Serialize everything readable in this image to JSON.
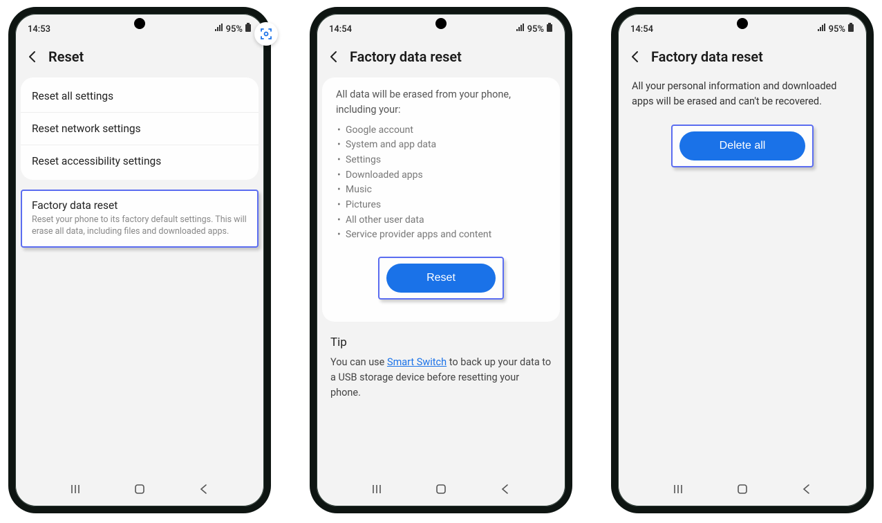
{
  "phones": [
    {
      "status": {
        "time": "14:53",
        "battery": "95%"
      },
      "title": "Reset",
      "items": [
        "Reset all settings",
        "Reset network settings",
        "Reset accessibility settings"
      ],
      "highlight": {
        "title": "Factory data reset",
        "desc": "Reset your phone to its factory default settings. This will erase all data, including files and downloaded apps."
      }
    },
    {
      "status": {
        "time": "14:54",
        "battery": "95%"
      },
      "title": "Factory data reset",
      "intro": "All data will be erased from your phone, including your:",
      "bullets": [
        "Google account",
        "System and app data",
        "Settings",
        "Downloaded apps",
        "Music",
        "Pictures",
        "All other user data",
        "Service provider apps and content"
      ],
      "button": "Reset",
      "tip_title": "Tip",
      "tip_before": "You can use ",
      "tip_link": "Smart Switch",
      "tip_after": " to back up your data to a USB storage device before resetting your phone."
    },
    {
      "status": {
        "time": "14:54",
        "battery": "95%"
      },
      "title": "Factory data reset",
      "body": "All your personal information and downloaded apps will be erased and can't be recovered.",
      "button": "Delete all"
    }
  ]
}
